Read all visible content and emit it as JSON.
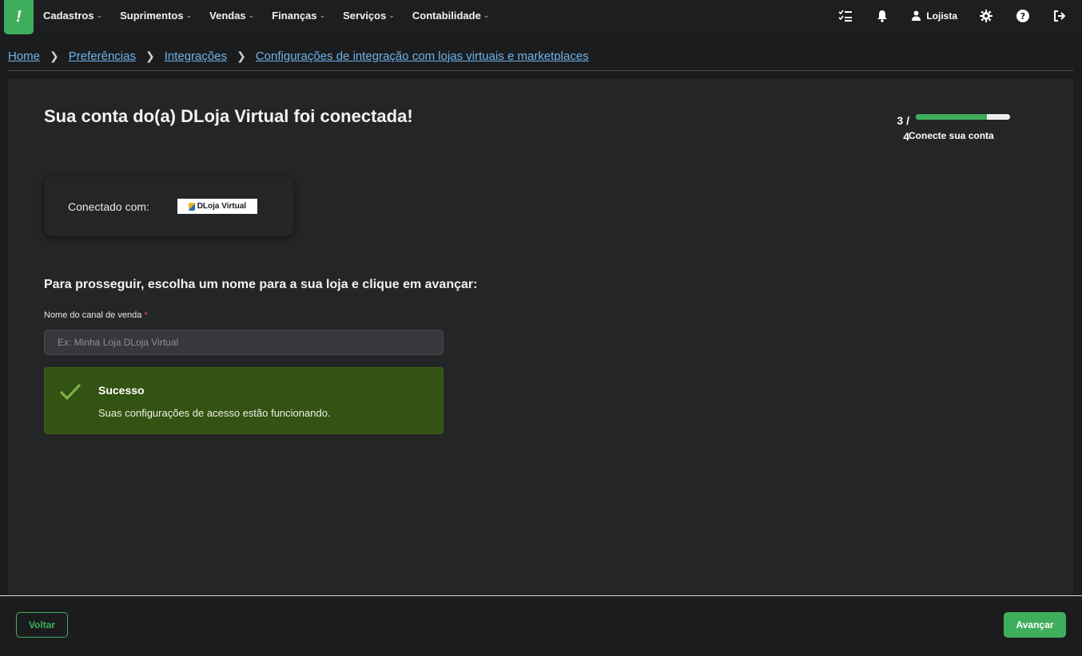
{
  "nav": {
    "logo_glyph": "!",
    "items": [
      {
        "label": "Cadastros"
      },
      {
        "label": "Suprimentos"
      },
      {
        "label": "Vendas"
      },
      {
        "label": "Finanças"
      },
      {
        "label": "Serviços"
      },
      {
        "label": "Contabilidade"
      }
    ],
    "user_label": "Lojista",
    "icons": [
      "tasks-icon",
      "bell-icon",
      "user-icon",
      "gear-icon",
      "help-icon",
      "logout-icon"
    ]
  },
  "breadcrumb": {
    "items": [
      {
        "label": "Home"
      },
      {
        "label": "Preferências"
      },
      {
        "label": "Integrações"
      },
      {
        "label": "Configurações de integração com lojas virtuais e marketplaces"
      }
    ]
  },
  "main": {
    "title": "Sua conta do(a) DLoja Virtual foi conectada!",
    "step": {
      "current": 3,
      "total": 4,
      "fraction_text_top": "3 /",
      "fraction_text_bottom": "4",
      "label": "Conecte sua conta",
      "progress": 0.75
    },
    "connected_label": "Conectado com:",
    "brand_name": "DLoja Virtual",
    "subtitle": "Para prosseguir, escolha um nome para a sua loja e clique em avançar:",
    "field": {
      "label": "Nome do canal de venda",
      "required_mark": "*",
      "placeholder": "Ex: Minha Loja DLoja Virtual",
      "value": ""
    },
    "alert": {
      "title": "Sucesso",
      "message": "Suas configurações de acesso estão funcionando."
    }
  },
  "footer": {
    "back_label": "Voltar",
    "next_label": "Avançar"
  },
  "colors": {
    "accent": "#3fae5c",
    "link": "#6fb3e8",
    "success_bg": "#325311",
    "panel_bg": "#242527"
  }
}
